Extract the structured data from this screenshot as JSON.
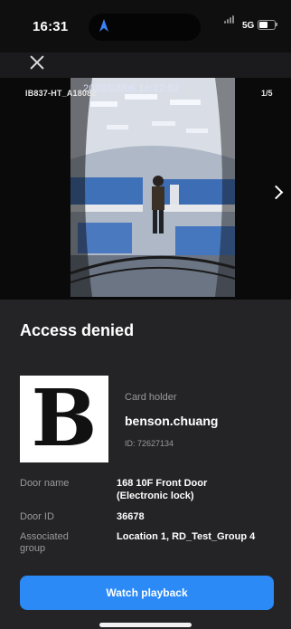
{
  "status_bar": {
    "time": "16:31",
    "network": "5G",
    "battery_level": 0.55
  },
  "event": {
    "camera_name": "IB837-HT_A18082",
    "page": "1/5",
    "timestamp": "2023/03/06 16:17:52",
    "title": "Access denied"
  },
  "card": {
    "logo_letter": "B",
    "holder_label": "Card holder",
    "holder_name": "benson.chuang",
    "holder_id": "ID: 72627134"
  },
  "details": {
    "door_name_label": "Door name",
    "door_name_line1": "168 10F Front Door",
    "door_name_line2": "(Electronic lock)",
    "door_id_label": "Door ID",
    "door_id": "36678",
    "group_label_line1": "Associated",
    "group_label_line2": "group",
    "group_value": "Location 1, RD_Test_Group 4"
  },
  "actions": {
    "watch_playback": "Watch playback"
  },
  "icons": {
    "close": "close-icon",
    "next": "chevron-right-icon",
    "location": "location-arrow-icon",
    "signal": "signal-icon",
    "battery": "battery-icon"
  }
}
